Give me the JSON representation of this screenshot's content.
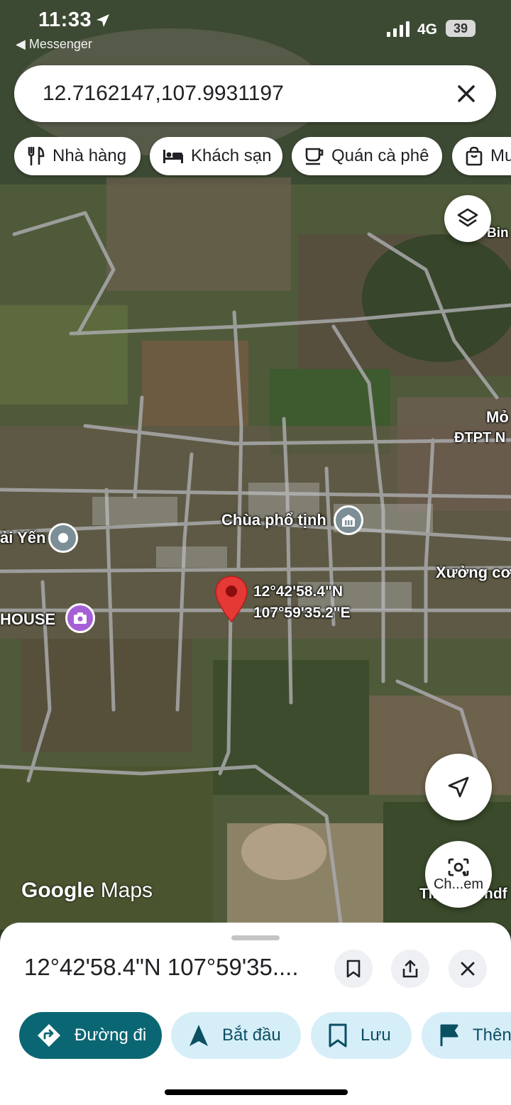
{
  "status_bar": {
    "time": "11:33",
    "back_app": "Messenger",
    "network": "4G",
    "battery": "39"
  },
  "search": {
    "value": "12.7162147,107.9931197"
  },
  "chips": [
    {
      "label": "Nhà hàng",
      "icon": "restaurant-icon"
    },
    {
      "label": "Khách sạn",
      "icon": "hotel-icon"
    },
    {
      "label": "Quán cà phê",
      "icon": "coffee-icon"
    },
    {
      "label": "Mu",
      "icon": "shopping-bag-icon"
    }
  ],
  "map": {
    "labels": {
      "bin": "Bin",
      "mo": "Mỏ",
      "dtpt": "ĐTPT N",
      "chua": "Chùa phổ tịnh",
      "hai_yen": "ải Yến",
      "house": "HOUSE",
      "xuong": "Xưởng cơ",
      "pin_lat": "12°42'58.4\"N",
      "pin_lng": "107°59'35.2\"E",
      "tinh": "Tinh",
      "mdf": "ndf"
    },
    "fab_camera_label": "Ch...em",
    "logo_google": "Google",
    "logo_maps": "Maps"
  },
  "sheet": {
    "title": "12°42'58.4\"N 107°59'35....",
    "actions": [
      {
        "label": "Đường đi",
        "icon": "directions-icon"
      },
      {
        "label": "Bắt đầu",
        "icon": "navigation-arrow-icon"
      },
      {
        "label": "Lưu",
        "icon": "bookmark-icon"
      },
      {
        "label": "Thên",
        "icon": "flag-icon"
      }
    ]
  },
  "colors": {
    "teal": "#0b6673",
    "light_blue": "#d6eef8",
    "pin_red": "#e53935",
    "poi_gray": "#7c8e96",
    "poi_purple": "#a65fd6"
  }
}
